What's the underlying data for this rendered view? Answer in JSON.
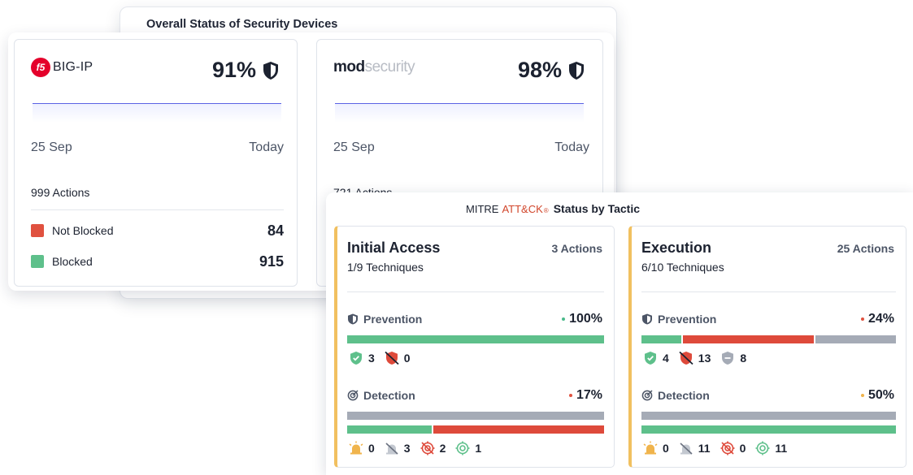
{
  "devices_panel": {
    "title": "Overall Status of Security Devices",
    "devices": [
      {
        "brand": "BIG-IP",
        "logo_text": "f5",
        "percent": "91%",
        "date_start": "25 Sep",
        "date_end": "Today",
        "actions": "999 Actions",
        "not_blocked_label": "Not Blocked",
        "not_blocked": "84",
        "blocked_label": "Blocked",
        "blocked": "915"
      },
      {
        "brand_part1": "mod",
        "brand_part2": "security",
        "percent": "98%",
        "date_start": "25 Sep",
        "date_end": "Today",
        "actions": "721 Actions"
      }
    ]
  },
  "mitre_panel": {
    "title_prefix": "MITRE",
    "title_brand": "ATT&CK",
    "title_reg": "®",
    "title_suffix": "Status by Tactic",
    "tactics": [
      {
        "name": "Initial Access",
        "techniques": "1/9 Techniques",
        "actions": "3 Actions",
        "prevention_label": "Prevention",
        "prevention_pct": "100%",
        "prevention_dot_color": "#49b98a",
        "prevention_bar": [
          {
            "color": "#5ec08b",
            "fraction": 1.0
          }
        ],
        "prevention_counts": {
          "blocked": "3",
          "not_blocked": "0"
        },
        "detection_label": "Detection",
        "detection_pct": "17%",
        "detection_dot_color": "#e0513f",
        "detection_bar_top": [
          {
            "color": "#a5abb6",
            "fraction": 1.0
          }
        ],
        "detection_bar_bottom": [
          {
            "color": "#5ec08b",
            "fraction": 0.33
          },
          {
            "color": "#de4a3b",
            "fraction": 0.67
          }
        ],
        "detection_counts": {
          "alert": "0",
          "silent": "3",
          "missed": "2",
          "detected": "1"
        }
      },
      {
        "name": "Execution",
        "techniques": "6/10 Techniques",
        "actions": "25 Actions",
        "prevention_label": "Prevention",
        "prevention_pct": "24%",
        "prevention_dot_color": "#e0513f",
        "prevention_bar": [
          {
            "color": "#5ec08b",
            "fraction": 0.16
          },
          {
            "color": "#de4a3b",
            "fraction": 0.52
          },
          {
            "color": "#a5abb6",
            "fraction": 0.32
          }
        ],
        "prevention_counts": {
          "blocked": "4",
          "not_blocked": "13",
          "neutral": "8"
        },
        "detection_label": "Detection",
        "detection_pct": "50%",
        "detection_dot_color": "#f0b44c",
        "detection_bar_top": [
          {
            "color": "#a5abb6",
            "fraction": 1.0
          }
        ],
        "detection_bar_bottom": [
          {
            "color": "#5ec08b",
            "fraction": 1.0
          }
        ],
        "detection_counts": {
          "alert": "0",
          "silent": "11",
          "missed": "0",
          "detected": "11"
        }
      }
    ]
  },
  "colors": {
    "not_blocked": "#e0513f",
    "blocked": "#5ec08b",
    "accent_line": "#5b63e4",
    "tactic_stripe": "#f1c060"
  }
}
